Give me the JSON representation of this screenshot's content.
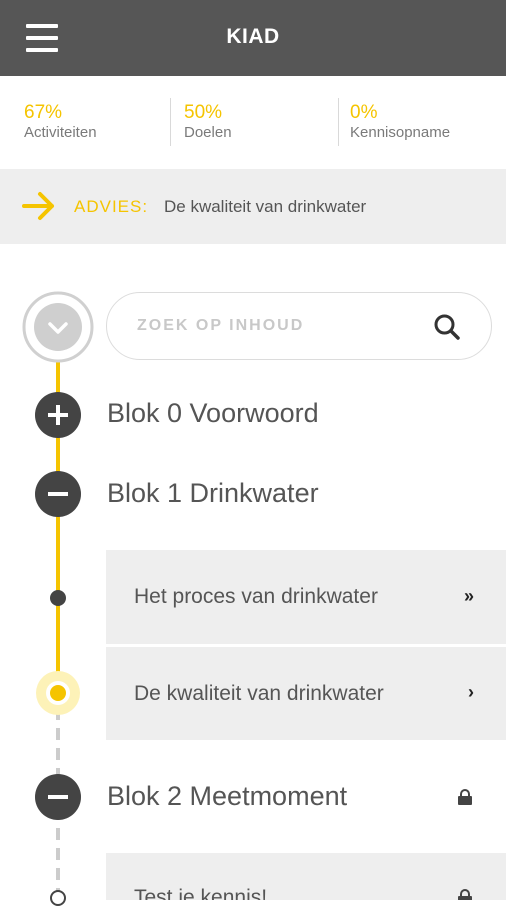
{
  "header": {
    "title": "KIAD"
  },
  "stats": [
    {
      "percent": "67%",
      "label": "Activiteiten"
    },
    {
      "percent": "50%",
      "label": "Doelen"
    },
    {
      "percent": "0%",
      "label": "Kennisopname"
    }
  ],
  "advice": {
    "tag": "ADVIES:",
    "text": "De kwaliteit van drinkwater"
  },
  "search": {
    "placeholder": "ZOEK OP INHOUD",
    "value": ""
  },
  "blocks": [
    {
      "title": "Blok 0 Voorwoord",
      "state": "collapsed"
    },
    {
      "title": "Blok 1 Drinkwater",
      "state": "expanded"
    },
    {
      "title": "Blok 2 Meetmoment",
      "state": "expanded",
      "locked": true
    }
  ],
  "lessons": [
    {
      "title": "Het proces van drinkwater",
      "chevron": "»"
    },
    {
      "title": "De kwaliteit van drinkwater",
      "chevron": "›"
    },
    {
      "title": "Test je kennis!",
      "locked": true
    }
  ],
  "colors": {
    "accent": "#f5c400",
    "header": "#565656",
    "panel": "#eeeeee",
    "icon": "#444444"
  }
}
